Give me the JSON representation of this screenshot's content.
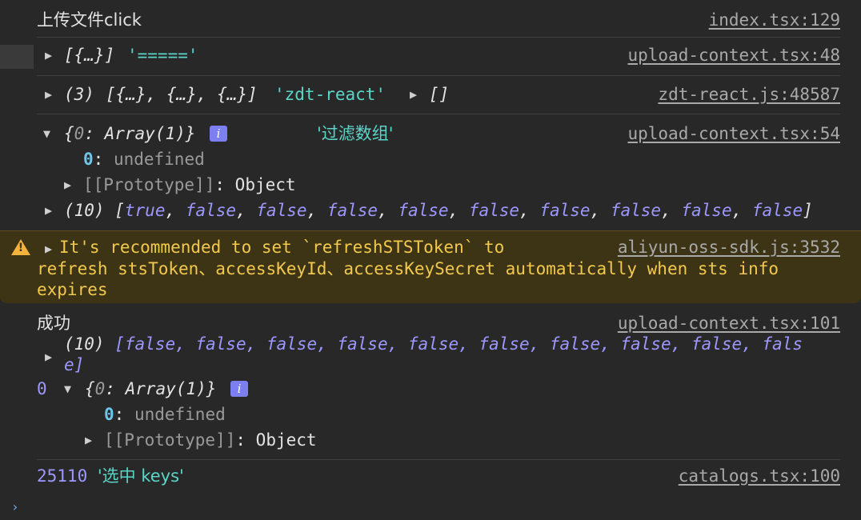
{
  "lines": {
    "l1": {
      "text": "上传文件click",
      "source": "index.tsx:129"
    },
    "l2": {
      "obj": "[{…}]",
      "str": "'====='",
      "source": "upload-context.tsx:48"
    },
    "l3": {
      "count": "(3)",
      "arr": "[{…}, {…}, {…}]",
      "str": "'zdt-react'",
      "arr2": "[]",
      "source": "zdt-react.js:48587"
    },
    "l4": {
      "open": "{",
      "key0": "0",
      "val0": ": Array(1)}",
      "info": "i",
      "str": "'过滤数组'",
      "source": "upload-context.tsx:54",
      "child0_key": "0",
      "child0_val": "undefined",
      "proto_label": "[[Prototype]]",
      "proto_val": "Object"
    },
    "l5": {
      "count": "(10)",
      "open": "[",
      "items": [
        "true",
        "false",
        "false",
        "false",
        "false",
        "false",
        "false",
        "false",
        "false",
        "false"
      ],
      "sep": ", ",
      "close": "]"
    },
    "warning": {
      "line1": "It's recommended to set `refreshSTSToken` to",
      "line2": "refresh stsToken、accessKeyId、accessKeySecret automatically when sts info",
      "line3": "expires",
      "source": "aliyun-oss-sdk.js:3532"
    },
    "l6": {
      "label": "成功",
      "source": "upload-context.tsx:101",
      "count": "(10)",
      "arr_line1": "[false, false, false, false, false, false, false, false, false, fals",
      "arr_line2": "e]",
      "index": "0",
      "obj_open": "{",
      "obj_key": "0",
      "obj_val": ": Array(1)}",
      "info": "i",
      "child0_key": "0",
      "child0_val": "undefined",
      "proto_label": "[[Prototype]]",
      "proto_val": "Object"
    },
    "l7": {
      "num": "25110",
      "str": "'选中 keys'",
      "source": "catalogs.tsx:100"
    }
  },
  "colors": {
    "background": "#282828",
    "string": "#5cd5c8",
    "keyword": "#9d98ff",
    "warning_bg": "#3d3416",
    "warning_text": "#f2c94c"
  }
}
